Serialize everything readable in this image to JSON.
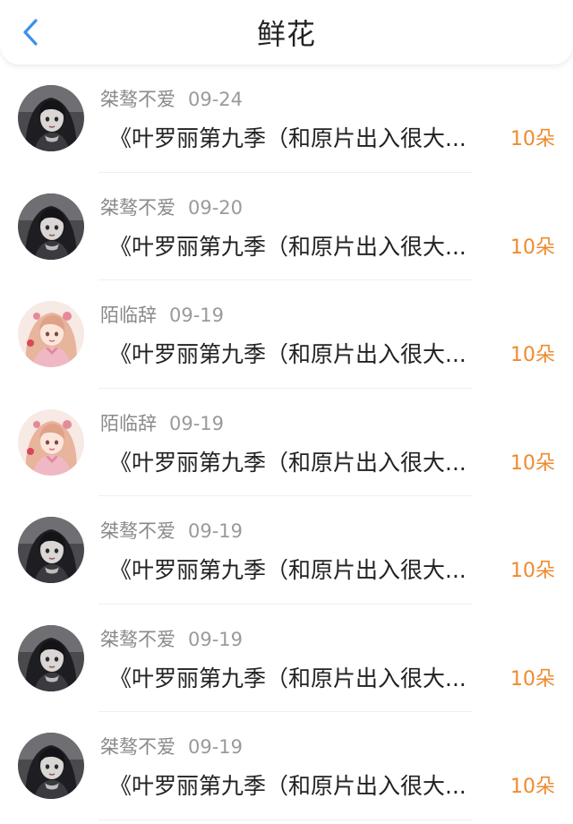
{
  "header": {
    "title": "鲜花",
    "back_icon": "chevron-left-icon",
    "accent_color": "#3d8ff0"
  },
  "items": [
    {
      "user": "桀骜不爱",
      "date": "09-24",
      "title": "《叶罗丽第九季（和原片出入很大...",
      "amount": "10朵",
      "avatar": "dark-hair-girl"
    },
    {
      "user": "桀骜不爱",
      "date": "09-20",
      "title": "《叶罗丽第九季（和原片出入很大...",
      "amount": "10朵",
      "avatar": "dark-hair-girl"
    },
    {
      "user": "陌临辞",
      "date": "09-19",
      "title": "《叶罗丽第九季（和原片出入很大...",
      "amount": "10朵",
      "avatar": "pink-hair-girl"
    },
    {
      "user": "陌临辞",
      "date": "09-19",
      "title": "《叶罗丽第九季（和原片出入很大...",
      "amount": "10朵",
      "avatar": "pink-hair-girl"
    },
    {
      "user": "桀骜不爱",
      "date": "09-19",
      "title": "《叶罗丽第九季（和原片出入很大...",
      "amount": "10朵",
      "avatar": "dark-hair-girl"
    },
    {
      "user": "桀骜不爱",
      "date": "09-19",
      "title": "《叶罗丽第九季（和原片出入很大...",
      "amount": "10朵",
      "avatar": "dark-hair-girl"
    },
    {
      "user": "桀骜不爱",
      "date": "09-19",
      "title": "《叶罗丽第九季（和原片出入很大...",
      "amount": "10朵",
      "avatar": "dark-hair-girl"
    }
  ],
  "colors": {
    "amount": "#f08a2c",
    "meta": "#8a8a8a"
  }
}
